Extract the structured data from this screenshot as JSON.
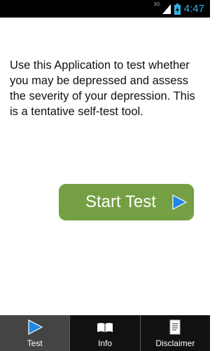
{
  "status_bar": {
    "network": "3G",
    "time": "4:47"
  },
  "main": {
    "intro_text": "Use this Application to test whether you may be depressed and assess the severity of your depression. This is a tentative self-test tool.",
    "start_button_label": "Start Test"
  },
  "tabs": [
    {
      "label": "Test",
      "icon": "play-icon",
      "selected": true
    },
    {
      "label": "Info",
      "icon": "book-icon",
      "selected": false
    },
    {
      "label": "Disclaimer",
      "icon": "document-icon",
      "selected": false
    }
  ],
  "colors": {
    "status_accent": "#33b5e5",
    "button_green": "#74a043",
    "play_blue": "#1e88e5"
  }
}
